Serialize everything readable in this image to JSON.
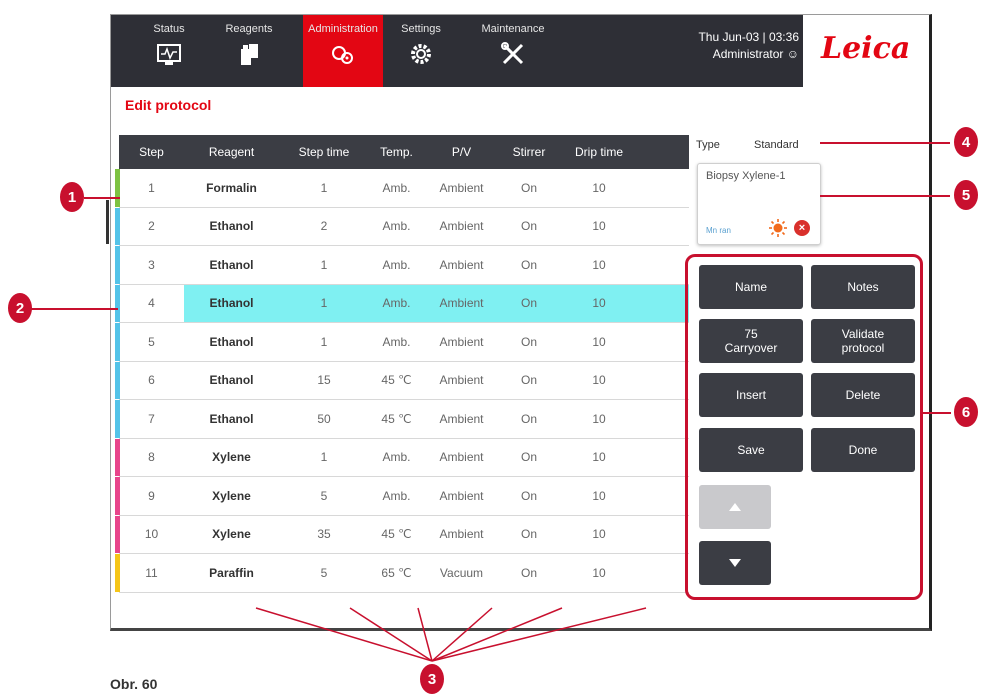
{
  "nav": {
    "tabs": [
      {
        "label": "Status",
        "icon": "status-monitor-icon"
      },
      {
        "label": "Reagents",
        "icon": "reagent-bottles-icon"
      },
      {
        "label": "Administration",
        "icon": "administration-icon",
        "active": true
      },
      {
        "label": "Settings",
        "icon": "gear-icon"
      },
      {
        "label": "Maintenance",
        "icon": "tools-icon"
      }
    ],
    "date_time": "Thu Jun-03 | 03:36",
    "user": "Administrator",
    "logo": "Leica"
  },
  "page_title": "Edit protocol",
  "table": {
    "headers": [
      "Step",
      "Reagent",
      "Step time",
      "Temp.",
      "P/V",
      "Stirrer",
      "Drip time"
    ],
    "rows": [
      {
        "step": "1",
        "reagent": "Formalin",
        "time": "1",
        "temp": "Amb.",
        "pv": "Ambient",
        "stirrer": "On",
        "drip": "10",
        "color": "#7dc242"
      },
      {
        "step": "2",
        "reagent": "Ethanol",
        "time": "2",
        "temp": "Amb.",
        "pv": "Ambient",
        "stirrer": "On",
        "drip": "10",
        "color": "#54c3e8"
      },
      {
        "step": "3",
        "reagent": "Ethanol",
        "time": "1",
        "temp": "Amb.",
        "pv": "Ambient",
        "stirrer": "On",
        "drip": "10",
        "color": "#54c3e8"
      },
      {
        "step": "4",
        "reagent": "Ethanol",
        "time": "1",
        "temp": "Amb.",
        "pv": "Ambient",
        "stirrer": "On",
        "drip": "10",
        "color": "#54c3e8",
        "selected": true
      },
      {
        "step": "5",
        "reagent": "Ethanol",
        "time": "1",
        "temp": "Amb.",
        "pv": "Ambient",
        "stirrer": "On",
        "drip": "10",
        "color": "#54c3e8"
      },
      {
        "step": "6",
        "reagent": "Ethanol",
        "time": "15",
        "temp": "45 ℃",
        "pv": "Ambient",
        "stirrer": "On",
        "drip": "10",
        "color": "#54c3e8"
      },
      {
        "step": "7",
        "reagent": "Ethanol",
        "time": "50",
        "temp": "45 ℃",
        "pv": "Ambient",
        "stirrer": "On",
        "drip": "10",
        "color": "#54c3e8"
      },
      {
        "step": "8",
        "reagent": "Xylene",
        "time": "1",
        "temp": "Amb.",
        "pv": "Ambient",
        "stirrer": "On",
        "drip": "10",
        "color": "#e8458b"
      },
      {
        "step": "9",
        "reagent": "Xylene",
        "time": "5",
        "temp": "Amb.",
        "pv": "Ambient",
        "stirrer": "On",
        "drip": "10",
        "color": "#e8458b"
      },
      {
        "step": "10",
        "reagent": "Xylene",
        "time": "35",
        "temp": "45 ℃",
        "pv": "Ambient",
        "stirrer": "On",
        "drip": "10",
        "color": "#e8458b"
      },
      {
        "step": "11",
        "reagent": "Paraffin",
        "time": "5",
        "temp": "65 ℃",
        "pv": "Vacuum",
        "stirrer": "On",
        "drip": "10",
        "color": "#f5c518"
      }
    ]
  },
  "side_panel": {
    "type_label": "Type",
    "type_value": "Standard",
    "reagent_card": {
      "name": "Biopsy Xylene-1",
      "sub": "Mn ran"
    }
  },
  "buttons": {
    "name": "Name",
    "notes": "Notes",
    "carryover": "75\nCarryover",
    "validate": "Validate\nprotocol",
    "insert": "Insert",
    "delete": "Delete",
    "save": "Save",
    "done": "Done"
  },
  "callouts": [
    "1",
    "2",
    "3",
    "4",
    "5",
    "6"
  ],
  "caption": "Obr. 60",
  "colors": {
    "accent_red": "#e30613",
    "callout_red": "#c8102e",
    "selected_row": "#7ff0f2",
    "header_dark": "#3b3d44"
  }
}
